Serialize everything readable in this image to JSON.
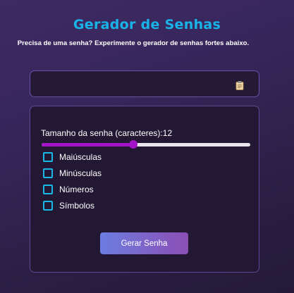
{
  "header": {
    "title": "Gerador de Senhas",
    "subtitle": "Precisa de uma senha? Experimente o gerador de senhas fortes abaixo."
  },
  "output": {
    "value": "",
    "copy_icon": "clipboard-icon"
  },
  "settings": {
    "length_label": "Tamanho da senha (caracteres):",
    "length_value": "12",
    "slider_fraction": 0.44,
    "options": [
      {
        "label": "Maiúsculas",
        "checked": false
      },
      {
        "label": "Minúsculas",
        "checked": false
      },
      {
        "label": "Números",
        "checked": false
      },
      {
        "label": "Símbolos",
        "checked": false
      }
    ]
  },
  "actions": {
    "generate_label": "Gerar Senha"
  },
  "colors": {
    "accent": "#18b4e8",
    "slider": "#a313c7",
    "button_start": "#6c7de0",
    "button_end": "#8a4fb5"
  }
}
